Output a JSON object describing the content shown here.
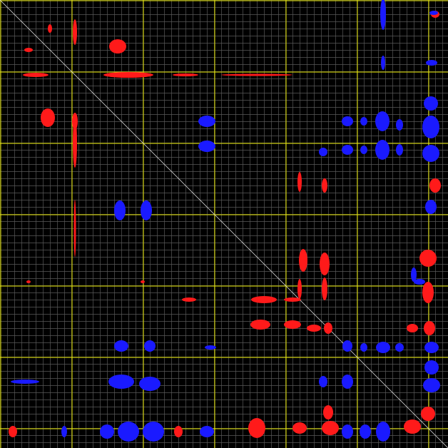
{
  "colors": {
    "background": "#000000",
    "minor_grid": "#5a5a5a",
    "major_grid": "#e8e800",
    "diagonal": "#cfcfcf",
    "positive_peaks": "#ff1a1a",
    "negative_peaks": "#1a1aff"
  },
  "view": {
    "type": "2D contour spectrum (symmetric correlation map)",
    "grid": "on",
    "axis_labels_visible": false
  }
}
